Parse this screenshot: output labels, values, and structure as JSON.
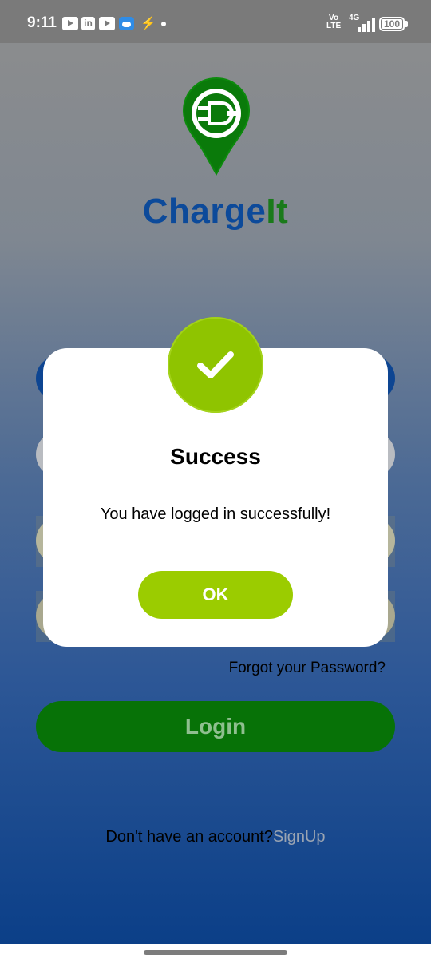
{
  "status_bar": {
    "time": "9:11",
    "notification_icons": [
      "youtube-icon",
      "linkedin-icon",
      "youtube-icon",
      "weather-icon",
      "bolt-icon",
      "dot-icon"
    ],
    "linkedin_glyph": "in",
    "volte_label": "Vo\nLTE",
    "network_label": "4G",
    "battery_level": "100"
  },
  "app": {
    "name_part1": "Charge",
    "name_part2": "It",
    "logo_icon": "ev-plug-location-pin-icon",
    "colors": {
      "brand_blue": "#0c4a9a",
      "brand_green": "#1a7a1a"
    }
  },
  "login_form": {
    "forgot_password_label": "Forgot your Password?",
    "login_label": "Login",
    "signup_prompt": "Don't have an account?",
    "signup_label": "SignUp",
    "colors": {
      "login_button": "#077207"
    }
  },
  "dialog": {
    "icon": "checkmark-icon",
    "title": "Success",
    "message": "You have logged in successfully!",
    "ok_label": "OK",
    "colors": {
      "accent": "#9bcc00"
    }
  }
}
